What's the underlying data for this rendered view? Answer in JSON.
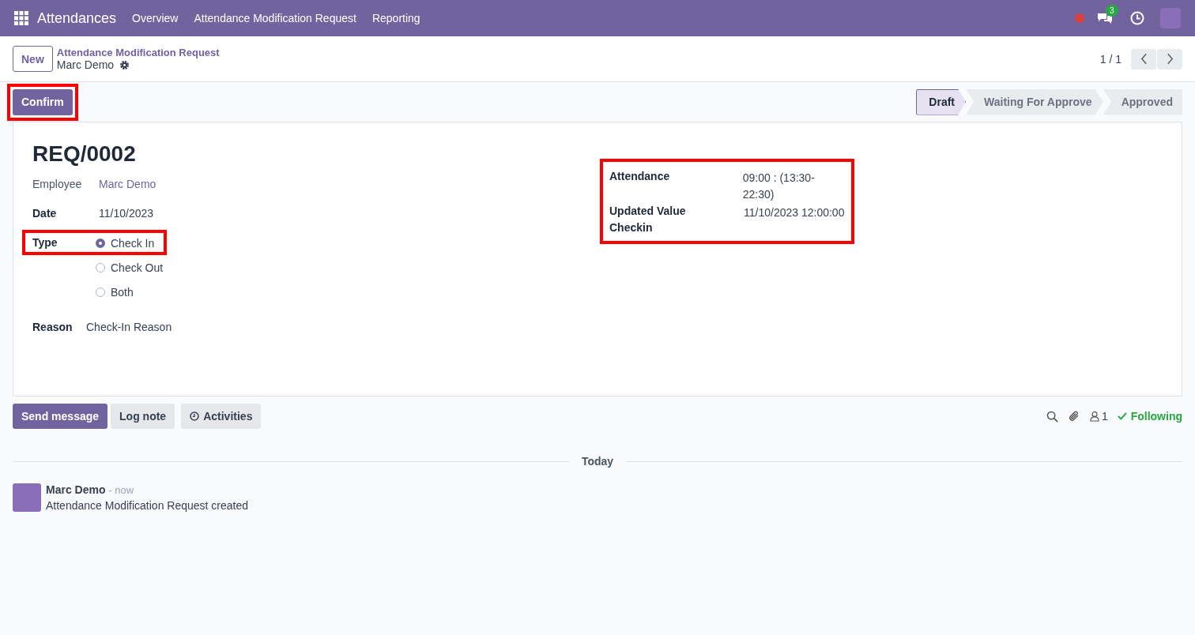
{
  "navbar": {
    "app_name": "Attendances",
    "menu": [
      "Overview",
      "Attendance Modification Request",
      "Reporting"
    ],
    "chat_badge": "3"
  },
  "breadcrumb": {
    "new_button": "New",
    "parent": "Attendance Modification Request",
    "current": "Marc Demo",
    "pager": "1 / 1"
  },
  "actions": {
    "confirm": "Confirm"
  },
  "statusbar": [
    {
      "label": "Draft",
      "selected": true
    },
    {
      "label": "Waiting For Approve",
      "selected": false
    },
    {
      "label": "Approved",
      "selected": false
    }
  ],
  "record": {
    "title": "REQ/0002",
    "employee": {
      "label": "Employee",
      "value": "Marc Demo"
    },
    "date": {
      "label": "Date",
      "value": "11/10/2023"
    },
    "type": {
      "label": "Type",
      "options": [
        {
          "label": "Check In",
          "selected": true
        },
        {
          "label": "Check Out",
          "selected": false
        },
        {
          "label": "Both",
          "selected": false
        }
      ]
    },
    "reason": {
      "label": "Reason",
      "value": "Check-In Reason"
    }
  },
  "right_fields": [
    {
      "label": "Attendance",
      "value": "09:00 : (13:30-22:30)"
    },
    {
      "label": "Updated Value Checkin",
      "value": "11/10/2023 12:00:00"
    }
  ],
  "chatter": {
    "buttons": [
      {
        "label": "Send message",
        "kind": "primary"
      },
      {
        "label": "Log note",
        "kind": "secondary"
      },
      {
        "label": "Activities",
        "kind": "activities"
      }
    ],
    "followers": "1",
    "following": "Following",
    "date_separator": "Today",
    "messages": [
      {
        "author": "Marc Demo",
        "time": "- now",
        "body": "Attendance Modification Request created"
      }
    ]
  }
}
